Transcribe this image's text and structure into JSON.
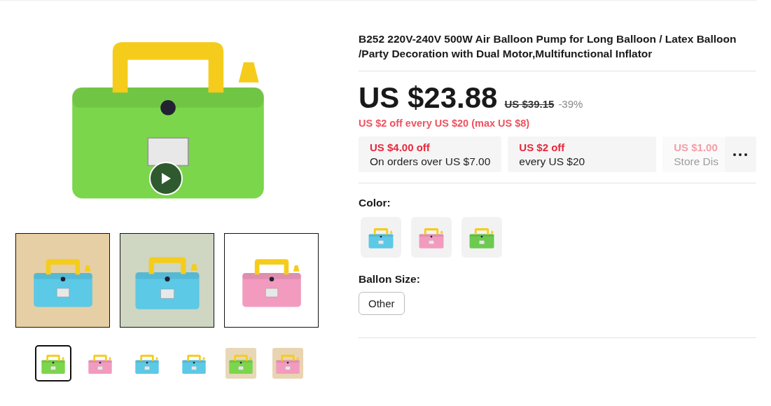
{
  "gallery": {
    "thumbnails": [
      {
        "selected": true
      },
      {
        "selected": false
      },
      {
        "selected": false
      },
      {
        "selected": false
      },
      {
        "selected": false
      },
      {
        "selected": false
      }
    ]
  },
  "product": {
    "title": "B252 220V-240V 500W Air Balloon Pump for Long Balloon / Latex Balloon /Party Decoration with Dual Motor,Multifunctional Inflator",
    "price": {
      "current": "US $23.88",
      "original": "US $39.15",
      "discount": "-39%"
    },
    "promo": "US $2 off every US $20 (max US $8)",
    "coupons": [
      {
        "amount": "US $4.00 off",
        "condition": "On orders over US $7.00",
        "faded": false
      },
      {
        "amount": "US $2 off",
        "condition": "every US $20",
        "faded": false
      },
      {
        "amount": "US $1.00",
        "condition": "Store Dis",
        "faded": true
      }
    ],
    "color": {
      "label": "Color:",
      "options": [
        {
          "color": "#5cc9e6",
          "selected": false
        },
        {
          "color": "#f29bbf",
          "selected": false
        },
        {
          "color": "#6ccb4e",
          "selected": false
        }
      ]
    },
    "size": {
      "label": "Ballon Size:",
      "options": [
        {
          "label": "Other",
          "selected": false
        }
      ]
    }
  }
}
